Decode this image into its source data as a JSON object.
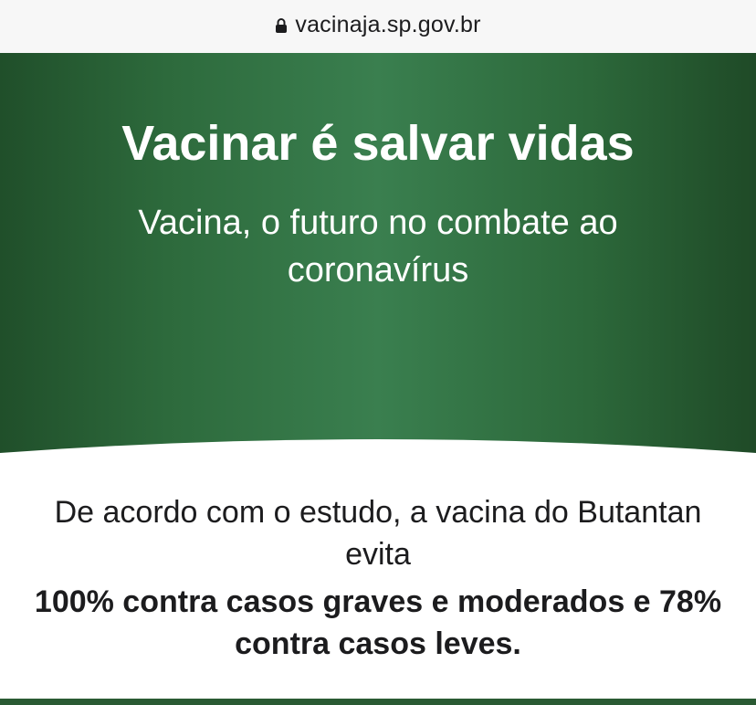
{
  "browser": {
    "url": "vacinaja.sp.gov.br",
    "lock_icon": "lock-icon"
  },
  "hero": {
    "title": "Vacinar é salvar vidas",
    "subtitle": "Vacina, o futuro no combate ao coronavírus",
    "colors": {
      "dark_green": "#204f2a",
      "mid_green": "#3a7f4f"
    }
  },
  "content": {
    "intro": "De acordo com o estudo, a vacina do Butantan evita",
    "highlight": "100% contra casos graves e moderados e 78% contra casos leves."
  }
}
